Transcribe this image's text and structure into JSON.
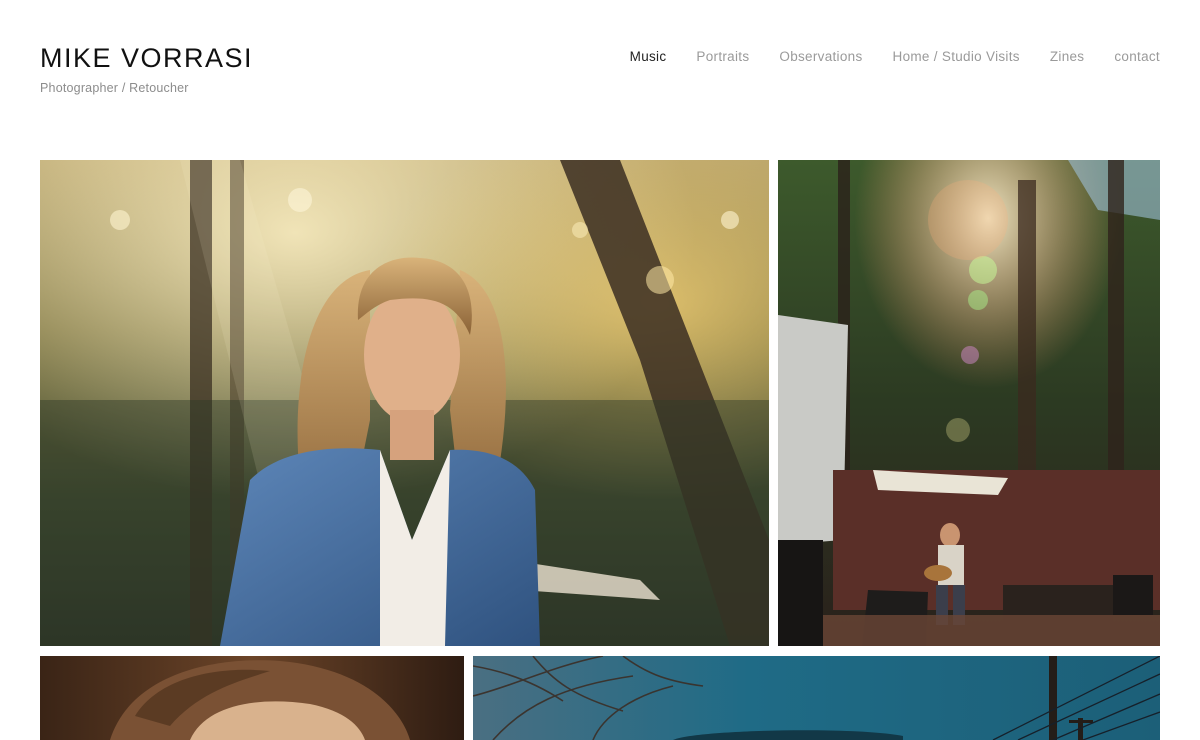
{
  "site": {
    "title": "MIKE VORRASI",
    "subtitle": "Photographer / Retoucher"
  },
  "nav": {
    "items": [
      {
        "label": "Music",
        "active": true
      },
      {
        "label": "Portraits",
        "active": false
      },
      {
        "label": "Observations",
        "active": false
      },
      {
        "label": "Home / Studio Visits",
        "active": false
      },
      {
        "label": "Zines",
        "active": false
      },
      {
        "label": "contact",
        "active": false
      }
    ]
  },
  "colors": {
    "title": "#111111",
    "subtitle": "#8c8c8c",
    "nav_inactive": "#9a9a9a",
    "nav_active": "#222222",
    "background": "#ffffff"
  }
}
